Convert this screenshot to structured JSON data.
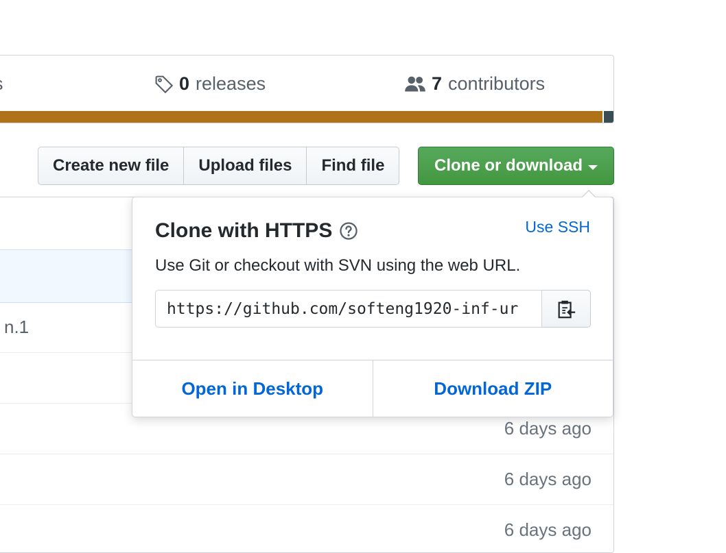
{
  "summary": {
    "partial_left": "s",
    "releases_count": "0",
    "releases_label": "releases",
    "contributors_count": "7",
    "contributors_label": "contributors"
  },
  "toolbar": {
    "create_new_file": "Create new file",
    "upload_files": "Upload files",
    "find_file": "Find file",
    "clone_or_download": "Clone or download"
  },
  "files": {
    "partial_row_text": "n.1",
    "rows": [
      {
        "age": "6 days ago"
      },
      {
        "age": "6 days ago"
      },
      {
        "age": "6 days ago"
      }
    ]
  },
  "clone_dropdown": {
    "title": "Clone with HTTPS",
    "use_ssh": "Use SSH",
    "description": "Use Git or checkout with SVN using the web URL.",
    "url": "https://github.com/softeng1920-inf-ur",
    "open_in_desktop": "Open in Desktop",
    "download_zip": "Download ZIP"
  },
  "colors": {
    "language_primary": "#b07219",
    "language_secondary": "#384d54",
    "clone_button": "#43973f",
    "link": "#0366d6"
  },
  "icons": [
    "tag-icon",
    "people-icon",
    "caret-down-icon",
    "question-icon",
    "clipboard-icon"
  ]
}
